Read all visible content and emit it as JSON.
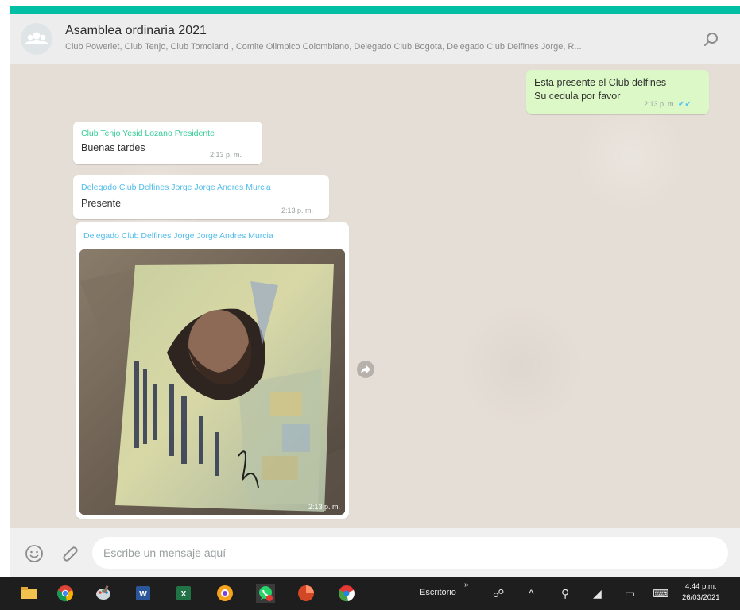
{
  "window": {
    "accent_color": "#00bfa5"
  },
  "header": {
    "title": "Asamblea ordinaria 2021",
    "subtitle": "Club Poweriet, Club Tenjo, Club Tomoland , Comite Olimpico Colombiano, Delegado Club Bogota, Delegado Club Delfines Jorge, R..."
  },
  "messages": [
    {
      "direction": "out",
      "lines": [
        "Esta presente el Club delfines",
        "Su cedula por favor"
      ],
      "time": "2:13 p. m.",
      "status": "read"
    },
    {
      "direction": "in",
      "sender": "Club Tenjo Yesid Lozano Presidente",
      "text": "Buenas tardes",
      "time": "2:13 p. m."
    },
    {
      "direction": "in",
      "sender": "Delegado Club Delfines Jorge Jorge Andres Murcia",
      "text": "Presente",
      "time": "2:13 p. m."
    },
    {
      "direction": "in",
      "sender": "Delegado Club Delfines Jorge Jorge Andres Murcia",
      "type": "image",
      "image_desc_icon": "id-card-photo",
      "time": "2:13 p. m."
    }
  ],
  "composer": {
    "placeholder": "Escribe un mensaje aquí"
  },
  "taskbar": {
    "apps": [
      "file-explorer-icon",
      "chrome-icon",
      "paint-icon",
      "word-icon",
      "excel-icon",
      "app-icon",
      "whatsapp-icon",
      "powerpoint-icon",
      "chrome-canary-icon"
    ],
    "toolbar_label": "Escritorio",
    "time": "4:44 p.m.",
    "date": "26/03/2021"
  }
}
